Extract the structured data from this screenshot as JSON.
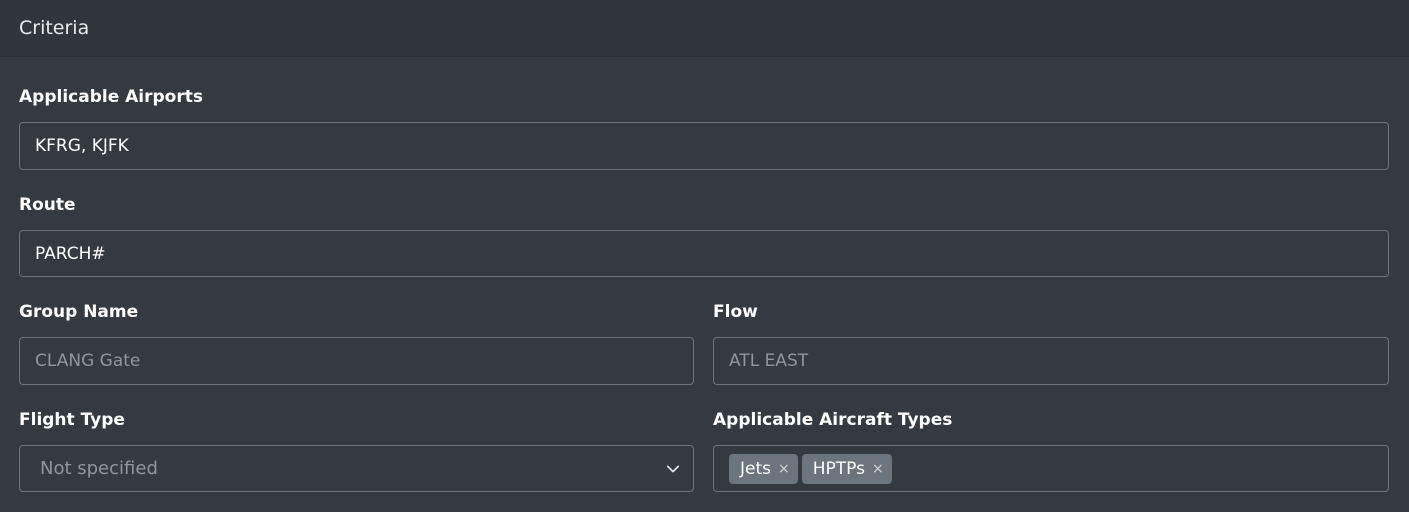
{
  "card": {
    "title": "Criteria"
  },
  "fields": {
    "applicable_airports": {
      "label": "Applicable Airports",
      "value": "KFRG, KJFK",
      "placeholder": ""
    },
    "route": {
      "label": "Route",
      "value": "PARCH#",
      "placeholder": ""
    },
    "group_name": {
      "label": "Group Name",
      "value": "",
      "placeholder": "CLANG Gate"
    },
    "flow": {
      "label": "Flow",
      "value": "",
      "placeholder": "ATL EAST"
    },
    "flight_type": {
      "label": "Flight Type",
      "selected": "Not specified"
    },
    "aircraft_types": {
      "label": "Applicable Aircraft Types",
      "tags": [
        "Jets",
        "HPTPs"
      ],
      "remove_glyph": "×"
    }
  },
  "icons": {
    "select_chevron": "chevron-down-icon",
    "tag_remove": "close-icon"
  },
  "colors": {
    "background": "#343a40",
    "header_background": "#30363c",
    "field_border": "#6c757d",
    "tag_background": "#6c757d",
    "placeholder_text": "#8f969c"
  }
}
